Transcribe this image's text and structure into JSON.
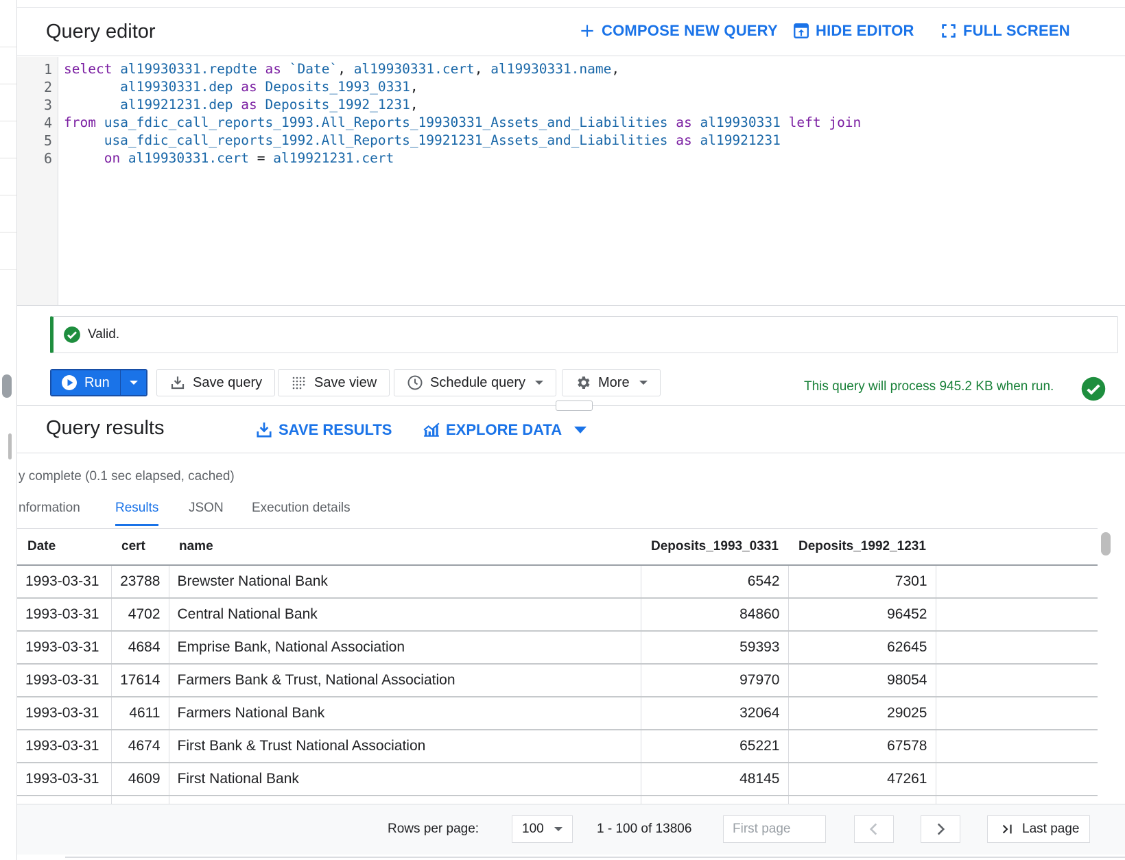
{
  "editor": {
    "title": "Query editor",
    "compose_label": "COMPOSE NEW QUERY",
    "hide_label": "HIDE EDITOR",
    "fullscreen_label": "FULL SCREEN",
    "line_numbers": [
      "1",
      "2",
      "3",
      "4",
      "5",
      "6"
    ]
  },
  "validation": {
    "text": "Valid."
  },
  "toolbar": {
    "run_label": "Run",
    "save_query_label": "Save query",
    "save_view_label": "Save view",
    "schedule_label": "Schedule query",
    "more_label": "More",
    "process_text": "This query will process 945.2 KB when run."
  },
  "results": {
    "title": "Query results",
    "save_results_label": "SAVE RESULTS",
    "explore_label": "EXPLORE DATA",
    "status": "y complete (0.1 sec elapsed, cached)",
    "tabs": [
      "nformation",
      "Results",
      "JSON",
      "Execution details"
    ],
    "columns": [
      "Date",
      "cert",
      "name",
      "Deposits_1993_0331",
      "Deposits_1992_1231"
    ],
    "rows": [
      [
        "1993-03-31",
        "23788",
        "Brewster National Bank",
        "6542",
        "7301"
      ],
      [
        "1993-03-31",
        "4702",
        "Central National Bank",
        "84860",
        "96452"
      ],
      [
        "1993-03-31",
        "4684",
        "Emprise Bank, National Association",
        "59393",
        "62645"
      ],
      [
        "1993-03-31",
        "17614",
        "Farmers Bank & Trust, National Association",
        "97970",
        "98054"
      ],
      [
        "1993-03-31",
        "4611",
        "Farmers National Bank",
        "32064",
        "29025"
      ],
      [
        "1993-03-31",
        "4674",
        "First Bank & Trust National Association",
        "65221",
        "67578"
      ],
      [
        "1993-03-31",
        "4609",
        "First National Bank",
        "48145",
        "47261"
      ]
    ]
  },
  "pagination": {
    "rows_per_page_label": "Rows per page:",
    "rows_per_page_value": "100",
    "range": "1 - 100 of 13806",
    "first_page_label": "First page",
    "last_page_label": "Last page"
  },
  "colors": {
    "accent": "#1a73e8",
    "success": "#1e8e3e",
    "keyword": "#7b1fa2",
    "identifier": "#1967a8"
  }
}
